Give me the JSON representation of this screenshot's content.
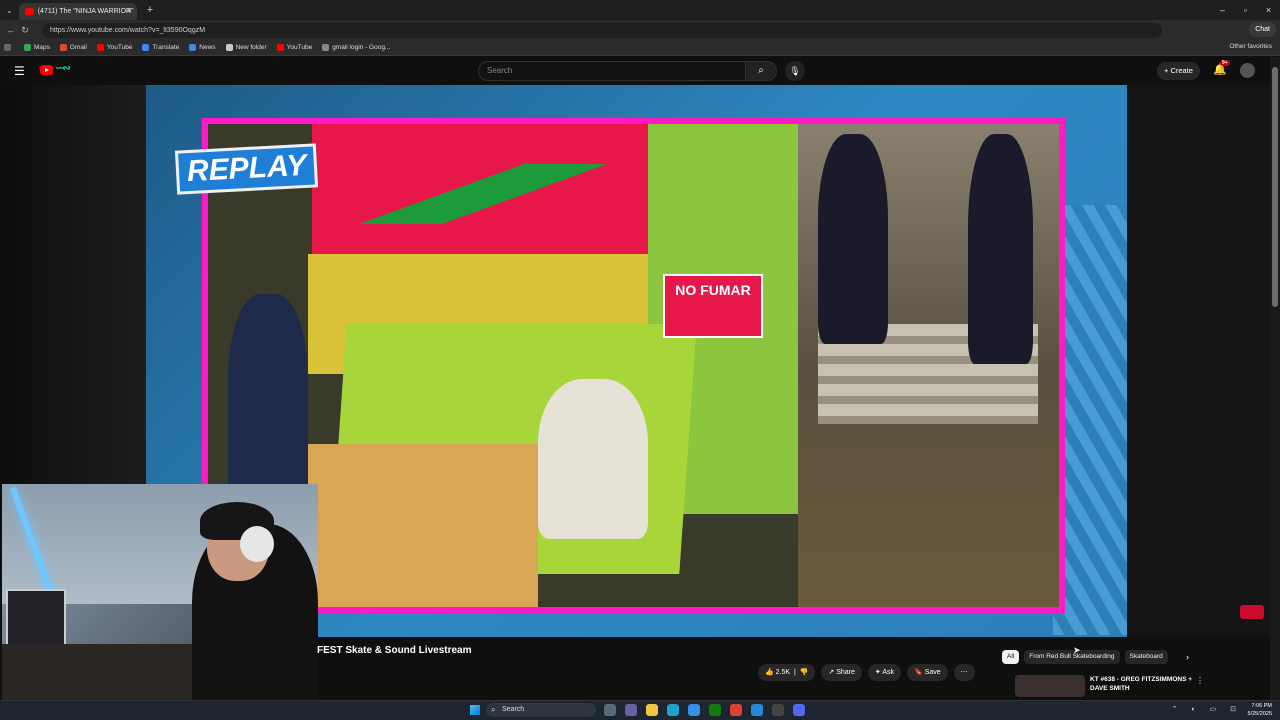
{
  "browser": {
    "tab_title": "(4711) The \"NINJA WARRIOR\"",
    "url": "https://www.youtube.com/watch?v=_lt3590OqgzM",
    "chat_label": "Chat",
    "bookmarks": [
      {
        "label": "Maps",
        "color": "#34a853"
      },
      {
        "label": "Gmail",
        "color": "#ea4335"
      },
      {
        "label": "YouTube",
        "color": "#ff0000"
      },
      {
        "label": "Translate",
        "color": "#4285f4"
      },
      {
        "label": "News",
        "color": "#4285f4"
      },
      {
        "label": "New folder",
        "color": "#c9c9c9"
      },
      {
        "label": "YouTube",
        "color": "#ff0000"
      },
      {
        "label": "gmail login - Goog...",
        "color": "#888888"
      }
    ],
    "other_favorites": "Other favorites"
  },
  "youtube": {
    "search_placeholder": "Search",
    "create_label": "Create",
    "notification_count": "9+",
    "video_title": "FEST Skate & Sound Livestream",
    "overlay_text": "REPLAY",
    "sign_text": "NO FUMAR",
    "actions": {
      "likes": "2.5K",
      "share": "Share",
      "ask": "Ask",
      "save": "Save"
    },
    "chips": [
      "All",
      "From Red Bull Skateboarding",
      "Skateboard"
    ],
    "recommended": {
      "title": "KT #638 - GREG FITZSIMMONS + DAVE SMITH"
    }
  },
  "taskbar": {
    "search_label": "Search",
    "time": "7:06 PM",
    "date": "5/25/2025"
  },
  "colors": {
    "frame_accent": "#ff1ac6",
    "youtube_red": "#ff0000"
  }
}
